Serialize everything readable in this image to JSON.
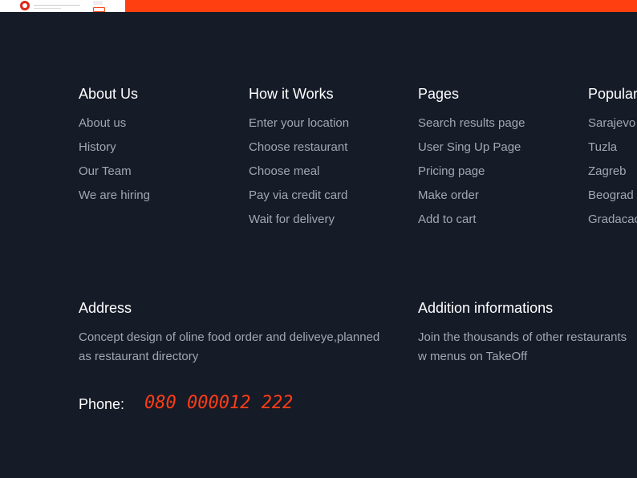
{
  "columns": [
    {
      "title": "About Us",
      "items": [
        "About us",
        "History",
        "Our Team",
        "We are hiring"
      ]
    },
    {
      "title": "How it Works",
      "items": [
        "Enter your location",
        "Choose restaurant",
        "Choose meal",
        "Pay via credit card",
        "Wait for delivery"
      ]
    },
    {
      "title": "Pages",
      "items": [
        "Search results page",
        "User Sing Up Page",
        "Pricing page",
        "Make order",
        "Add to cart"
      ]
    },
    {
      "title": "Popular",
      "items": [
        "Sarajevo",
        "Tuzla",
        "Zagreb",
        "Beograd",
        "Gradacac"
      ]
    }
  ],
  "address": {
    "title": "Address",
    "text": "Concept design of oline food order and deliveye,planned as restaurant directory"
  },
  "additional": {
    "title": "Addition informations",
    "text": "Join the thousands of other restaurants w menus on TakeOff"
  },
  "phone": {
    "label": "Phone:",
    "value": "080 000012 222"
  },
  "colors": {
    "background": "#151b27",
    "accent": "#ff3f0f",
    "heading": "#ffffff",
    "link": "#a2a7b3"
  }
}
